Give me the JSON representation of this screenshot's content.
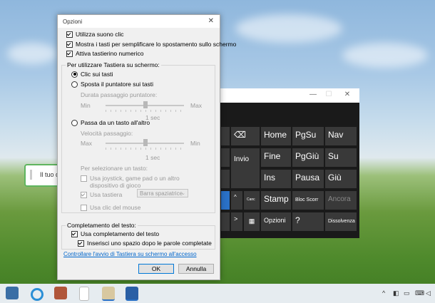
{
  "desktop": {
    "toast_text": "Il tuo d"
  },
  "dialog": {
    "title": "Opzioni",
    "close": "✕",
    "checkboxes_top": [
      {
        "label": "Utilizza suono clic",
        "checked": true
      },
      {
        "label": "Mostra i tasti per semplificare lo spostamento sullo schermo",
        "checked": true
      },
      {
        "label": "Attiva tastierino numerico",
        "checked": true
      }
    ],
    "usage_group_label": "Per utilizzare Tastiera su schermo:",
    "radio_click": "Clic sui tasti",
    "radio_hover": "Sposta il puntatore sui tasti",
    "hover_duration_label": "Durata passaggio puntatore:",
    "hover_min": "Min",
    "hover_max": "Max",
    "hover_value": "1 sec",
    "radio_scan": "Passa da un tasto all'altro",
    "scan_speed_label": "Velocità passaggio:",
    "scan_max": "Max",
    "scan_min": "Min",
    "scan_value": "1 sec",
    "select_key_label": "Per selezionare un tasto:",
    "opt_joystick": "Usa joystick, game pad o un altro dispositivo di gioco",
    "opt_keyboard": "Usa tastiera",
    "keyboard_key_select": "Barra spaziatrice",
    "opt_mouse": "Usa clic del mouse",
    "completion_group_label": "Completamento del testo:",
    "opt_completion": "Usa completamento del testo",
    "opt_space_after": "Inserisci uno spazio dopo le parole completate",
    "help_link": "Controllare l'avvio di Tastiera su schermo all'accesso",
    "ok": "OK",
    "cancel": "Annulla"
  },
  "osk": {
    "title_minimize": "—",
    "title_maximize": "☐",
    "title_close": "✕",
    "keys": {
      "home": "Home",
      "pgsu": "PgSu",
      "nav": "Nav",
      "invio": "Invio",
      "fine": "Fine",
      "pggiu": "PgGiù",
      "su": "Su",
      "ins": "Ins",
      "pausa": "Pausa",
      "giu": "Giù",
      "stamp": "Stamp",
      "bloc_scorr": "Bloc Scorr",
      "ancora": "Ancora",
      "canc": "Canc",
      "opzioni": "Opzioni",
      "help": "?",
      "dissolvenza": "Dissolvenza",
      "backspace": "⌫",
      "arrow_right": ">",
      "arrow_up": "^"
    }
  },
  "taskbar": {
    "icons": [
      "calculator-icon",
      "cortana-icon",
      "box-icon",
      "file-icon",
      "folder-icon",
      "osk-icon"
    ],
    "tray_chevron": "^"
  },
  "colors": {
    "osk_key": "#393939",
    "osk_key_highlight": "#2a71c7",
    "link": "#0066cc",
    "ok_border": "#0078d7"
  }
}
